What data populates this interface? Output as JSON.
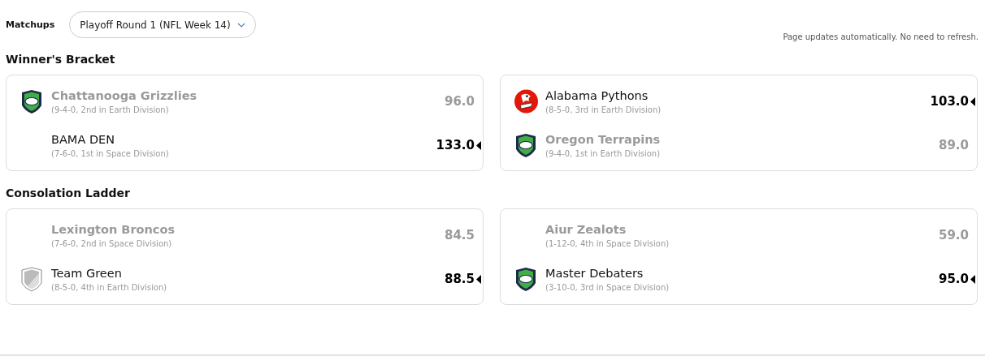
{
  "header": {
    "label": "Matchups",
    "dropdown": "Playoff Round 1 (NFL Week 14)",
    "note": "Page updates automatically. No need to refresh."
  },
  "sections": [
    {
      "title": "Winner's Bracket",
      "matchups": [
        {
          "teams": [
            {
              "name": "Chattanooga Grizzlies",
              "record": "(9-4-0, 2nd in Earth Division)",
              "score": "96.0",
              "winner": false,
              "kind": "football-shield"
            },
            {
              "name": "BAMA DEN",
              "record": "(7-6-0, 1st in Space Division)",
              "score": "133.0",
              "winner": true,
              "kind": "none"
            }
          ]
        },
        {
          "teams": [
            {
              "name": "Alabama Pythons",
              "record": "(8-5-0, 3rd in Earth Division)",
              "score": "103.0",
              "winner": true,
              "kind": "mascot-circle"
            },
            {
              "name": "Oregon Terrapins",
              "record": "(9-4-0, 1st in Earth Division)",
              "score": "89.0",
              "winner": false,
              "kind": "football-shield"
            }
          ]
        }
      ]
    },
    {
      "title": "Consolation Ladder",
      "matchups": [
        {
          "teams": [
            {
              "name": "Lexington Broncos",
              "record": "(7-6-0, 2nd in Space Division)",
              "score": "84.5",
              "winner": false,
              "kind": "none"
            },
            {
              "name": "Team Green",
              "record": "(8-5-0, 4th in Earth Division)",
              "score": "88.5",
              "winner": true,
              "kind": "plain-shield"
            }
          ]
        },
        {
          "teams": [
            {
              "name": "Aiur Zealots",
              "record": "(1-12-0, 4th in Space Division)",
              "score": "59.0",
              "winner": false,
              "kind": "none"
            },
            {
              "name": "Master Debaters",
              "record": "(3-10-0, 3rd in Space Division)",
              "score": "95.0",
              "winner": true,
              "kind": "football-shield"
            }
          ]
        }
      ]
    }
  ]
}
